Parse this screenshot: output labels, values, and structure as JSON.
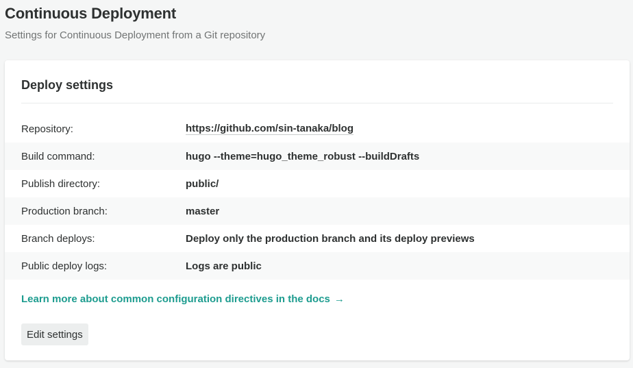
{
  "header": {
    "title": "Continuous Deployment",
    "subtitle": "Settings for Continuous Deployment from a Git repository"
  },
  "card": {
    "title": "Deploy settings",
    "rows": [
      {
        "label": "Repository:",
        "value": "https://github.com/sin-tanaka/blog"
      },
      {
        "label": "Build command:",
        "value": "hugo --theme=hugo_theme_robust --buildDrafts"
      },
      {
        "label": "Publish directory:",
        "value": "public/"
      },
      {
        "label": "Production branch:",
        "value": "master"
      },
      {
        "label": "Branch deploys:",
        "value": "Deploy only the production branch and its deploy previews"
      },
      {
        "label": "Public deploy logs:",
        "value": "Logs are public"
      }
    ],
    "docs_link": {
      "label": "Learn more about common configuration directives in the docs",
      "icon": "arrow-right-icon"
    },
    "edit_button": "Edit settings"
  },
  "colors": {
    "background": "#f5f6f6",
    "accent_link": "#1d9c8f",
    "text": "#2e3131",
    "muted_text": "#717474"
  }
}
